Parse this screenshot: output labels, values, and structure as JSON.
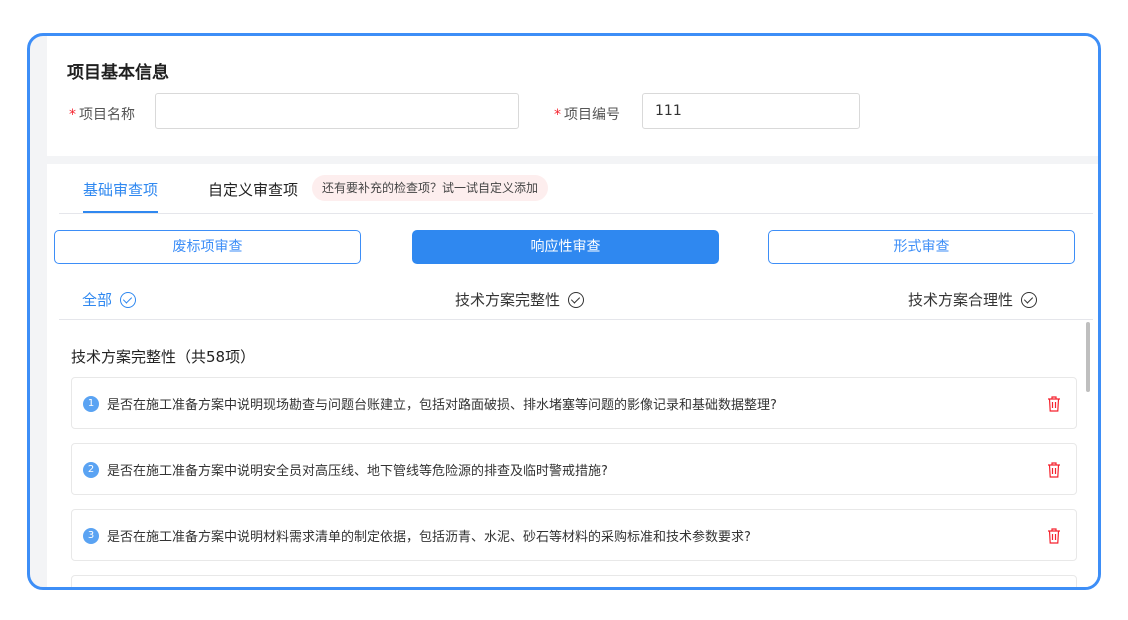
{
  "basic_info": {
    "title": "项目基本信息",
    "required_mark": "*",
    "project_name_label": "项目名称",
    "project_name_value": "",
    "project_number_label": "项目编号",
    "project_number_value": "111"
  },
  "tabs": {
    "basic": "基础审查项",
    "custom": "自定义审查项",
    "tip": "还有要补充的检查项？试一试自定义添加"
  },
  "segments": {
    "invalid_bid": "废标项审查",
    "responsiveness": "响应性审查",
    "formal": "形式审查"
  },
  "filters": {
    "all": "全部",
    "completeness": "技术方案完整性",
    "rationality": "技术方案合理性"
  },
  "section": {
    "title": "技术方案完整性（共58项）"
  },
  "items": [
    {
      "num": "1",
      "text": "是否在施工准备方案中说明现场勘查与问题台账建立，包括对路面破损、排水堵塞等问题的影像记录和基础数据整理?"
    },
    {
      "num": "2",
      "text": "是否在施工准备方案中说明安全员对高压线、地下管线等危险源的排查及临时警戒措施?"
    },
    {
      "num": "3",
      "text": "是否在施工准备方案中说明材料需求清单的制定依据，包括沥青、水泥、砂石等材料的采购标准和技术参数要求?"
    }
  ],
  "colors": {
    "accent": "#2f88f0",
    "frame_border": "#3d8ef7",
    "danger": "#f5222d",
    "tip_bg": "#fdeeee"
  },
  "icons": {
    "check": "check-circle-icon",
    "delete": "trash-icon"
  }
}
